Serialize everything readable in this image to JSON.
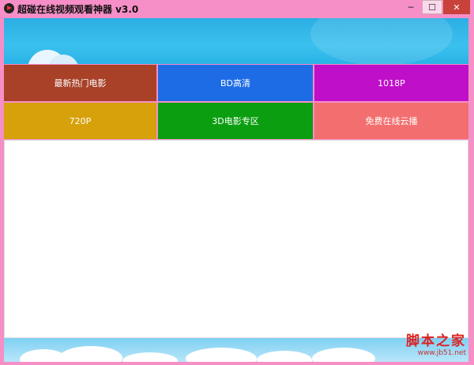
{
  "window": {
    "title": "超碰在线视频观看神器 v3.0",
    "controls": {
      "minimize": "─",
      "maximize": "☐",
      "close": "✕"
    }
  },
  "tiles": [
    {
      "label": "最新热门电影",
      "color": "#a84128"
    },
    {
      "label": "BD高清",
      "color": "#1d6ce6"
    },
    {
      "label": "1018P",
      "color": "#bf0fc8"
    },
    {
      "label": "720P",
      "color": "#d6a10a"
    },
    {
      "label": "3D电影专区",
      "color": "#0c9e11"
    },
    {
      "label": "免费在线云播",
      "color": "#f36f6f"
    }
  ],
  "watermark": {
    "main": "脚本之家",
    "sub": "www.jb51.net"
  }
}
